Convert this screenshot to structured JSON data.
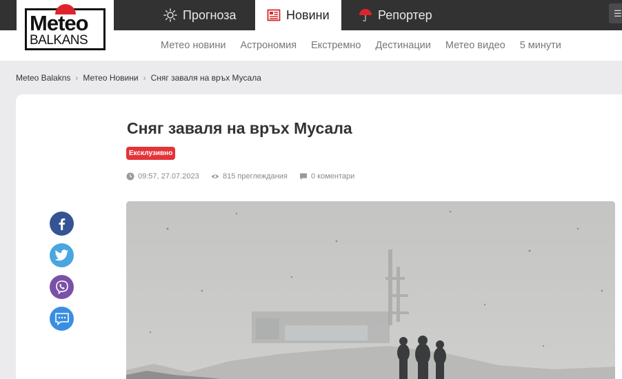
{
  "brand": {
    "logo_top": "Meteo",
    "logo_bottom": "BALKANS"
  },
  "top_tabs": [
    {
      "label": "Прогноза",
      "icon": "sun-icon"
    },
    {
      "label": "Новини",
      "icon": "newspaper-icon",
      "active": true
    },
    {
      "label": "Репортер",
      "icon": "umbrella-icon"
    }
  ],
  "sub_nav": [
    "Метео новини",
    "Астрономия",
    "Екстремно",
    "Дестинации",
    "Метео видео",
    "5 минути"
  ],
  "breadcrumb": [
    "Meteo Balakns",
    "Метео Новини",
    "Сняг заваля на връх Мусала"
  ],
  "article": {
    "title": "Сняг заваля на връх Мусала",
    "badge": "Ексклузивно",
    "time": "09:57, 27.07.2023",
    "views": "815 преглеждания",
    "comments": "0 коментари"
  },
  "share": [
    "facebook-icon",
    "twitter-icon",
    "viber-icon",
    "comment-icon"
  ],
  "colors": {
    "topbar": "#323233",
    "badge": "#e4343a",
    "facebook": "#355493",
    "twitter": "#49a6e0",
    "viber": "#7b51a8",
    "message": "#3a8ee2"
  }
}
